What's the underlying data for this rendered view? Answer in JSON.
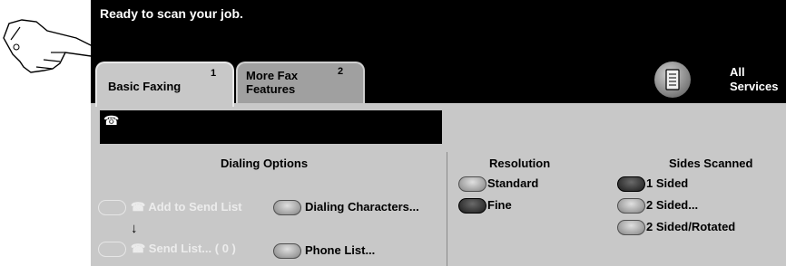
{
  "status_message": "Ready to scan your job.",
  "tabs": [
    {
      "label_line1": "Basic Faxing",
      "label_line2": "",
      "number": "1"
    },
    {
      "label_line1": "More Fax",
      "label_line2": "Features",
      "number": "2"
    }
  ],
  "all_services": {
    "line1": "All",
    "line2": "Services"
  },
  "phone_field": {
    "icon": "☎",
    "value": ""
  },
  "dialing_options": {
    "header": "Dialing Options",
    "add_to_send_list": "☎ Add to Send List",
    "arrow": "↓",
    "send_list": "☎ Send List... ( 0 )",
    "dialing_characters": "Dialing Characters...",
    "phone_list": "Phone List..."
  },
  "resolution": {
    "header": "Resolution",
    "options": [
      "Standard",
      "Fine"
    ],
    "selected": "Fine"
  },
  "sides_scanned": {
    "header": "Sides Scanned",
    "options": [
      "1 Sided",
      "2 Sided...",
      "2 Sided/Rotated"
    ],
    "selected": "1 Sided"
  },
  "icons": {
    "pointer": "pointing-hand-icon",
    "all_services": "all-services-icon",
    "phone": "phone-icon"
  }
}
